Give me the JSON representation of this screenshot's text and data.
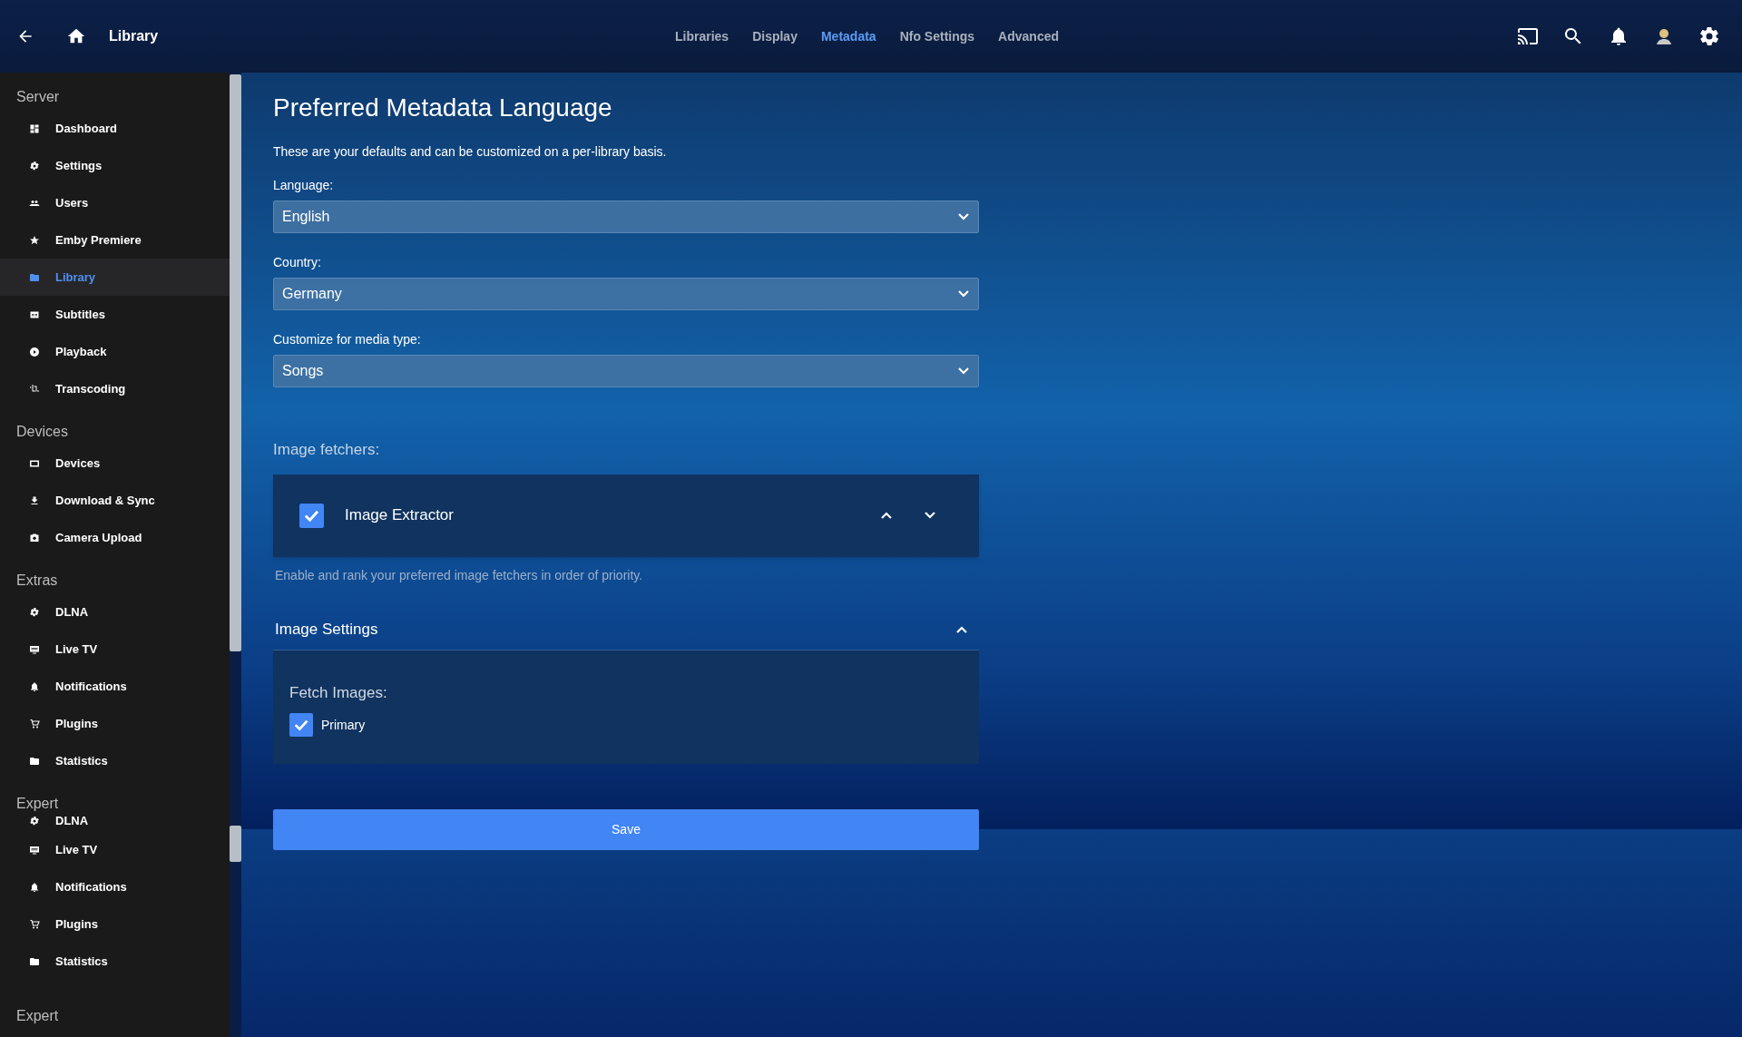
{
  "header": {
    "title": "Library",
    "tabs": [
      {
        "label": "Libraries",
        "selected": false
      },
      {
        "label": "Display",
        "selected": false
      },
      {
        "label": "Metadata",
        "selected": true
      },
      {
        "label": "Nfo Settings",
        "selected": false
      },
      {
        "label": "Advanced",
        "selected": false
      }
    ]
  },
  "sidebar": {
    "sections": [
      {
        "heading": "Server",
        "items": [
          {
            "label": "Dashboard",
            "selected": false
          },
          {
            "label": "Settings",
            "selected": false
          },
          {
            "label": "Users",
            "selected": false
          },
          {
            "label": "Emby Premiere",
            "selected": false
          },
          {
            "label": "Library",
            "selected": true
          },
          {
            "label": "Subtitles",
            "selected": false
          },
          {
            "label": "Playback",
            "selected": false
          },
          {
            "label": "Transcoding",
            "selected": false
          }
        ]
      },
      {
        "heading": "Devices",
        "items": [
          {
            "label": "Devices",
            "selected": false
          },
          {
            "label": "Download & Sync",
            "selected": false
          },
          {
            "label": "Camera Upload",
            "selected": false
          }
        ]
      },
      {
        "heading": "Extras",
        "items": [
          {
            "label": "DLNA",
            "selected": false
          },
          {
            "label": "Live TV",
            "selected": false
          },
          {
            "label": "Notifications",
            "selected": false
          },
          {
            "label": "Plugins",
            "selected": false
          },
          {
            "label": "Statistics",
            "selected": false
          }
        ]
      },
      {
        "heading": "Expert",
        "items": [
          {
            "label": "DLNA",
            "selected": false
          },
          {
            "label": "Live TV",
            "selected": false
          },
          {
            "label": "Notifications",
            "selected": false
          },
          {
            "label": "Plugins",
            "selected": false
          },
          {
            "label": "Statistics",
            "selected": false
          }
        ]
      },
      {
        "heading": "Expert"
      }
    ]
  },
  "main": {
    "title": "Preferred Metadata Language",
    "description": "These are your defaults and can be customized on a per-library basis.",
    "selects": [
      {
        "label": "Language:",
        "value": "English"
      },
      {
        "label": "Country:",
        "value": "Germany"
      },
      {
        "label": "Customize for media type:",
        "value": "Songs"
      }
    ],
    "image_fetchers": {
      "label": "Image fetchers:",
      "items": [
        {
          "name": "Image Extractor",
          "checked": true
        }
      ],
      "help": "Enable and rank your preferred image fetchers in order of priority."
    },
    "image_settings": {
      "title": "Image Settings",
      "expanded": true,
      "fetch_label": "Fetch Images:",
      "options": [
        {
          "label": "Primary",
          "checked": true
        }
      ]
    },
    "save": "Save"
  }
}
